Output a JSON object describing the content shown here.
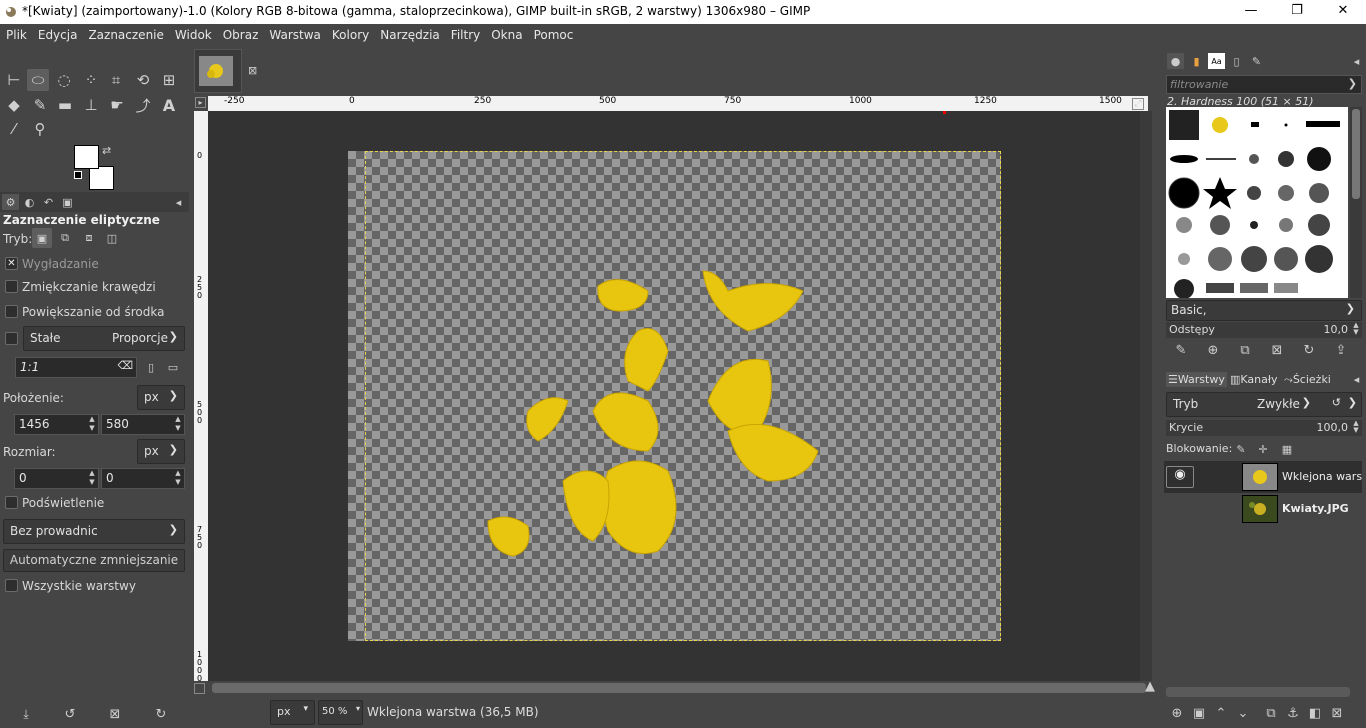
{
  "window": {
    "title": "*[Kwiaty] (zaimportowany)-1.0 (Kolory RGB 8-bitowa (gamma, staloprzecinkowa), GIMP built-in sRGB, 2 warstwy) 1306x980 – GIMP",
    "minimize": "—",
    "maximize": "❐",
    "close": "✕"
  },
  "menu": [
    "Plik",
    "Edycja",
    "Zaznaczenie",
    "Widok",
    "Obraz",
    "Warstwa",
    "Kolory",
    "Narzędzia",
    "Filtry",
    "Okna",
    "Pomoc"
  ],
  "tool_options": {
    "title": "Zaznaczenie eliptyczne",
    "mode_label": "Tryb:",
    "antialias": "Wygładzanie",
    "feather": "Zmiękczanie krawędzi",
    "expand_center": "Powiększanie od środka",
    "fixed_label": "Stałe",
    "fixed_value": "Proporcje",
    "ratio": "1:1",
    "position_label": "Położenie:",
    "position_unit": "px",
    "pos_x": "1456",
    "pos_y": "580",
    "size_label": "Rozmiar:",
    "size_unit": "px",
    "size_w": "0",
    "size_h": "0",
    "highlight": "Podświetlenie",
    "guides": "Bez prowadnic",
    "auto_shrink": "Automatyczne zmniejszanie",
    "all_layers": "Wszystkie warstwy"
  },
  "ruler": {
    "h_labels": [
      "-250",
      "0",
      "250",
      "500",
      "750",
      "1000",
      "1250",
      "1500"
    ],
    "v_labels": [
      "0",
      "250",
      "500",
      "750",
      "1000"
    ]
  },
  "status": {
    "unit": "px",
    "zoom": "50 %",
    "info": "Wklejona warstwa (36,5 MB)"
  },
  "brushes": {
    "filter_placeholder": "filtrowanie",
    "selected_name": "2. Hardness 100 (51 × 51)",
    "preset": "Basic,",
    "spacing_label": "Odstępy",
    "spacing_value": "10,0"
  },
  "layers": {
    "tabs": [
      "Warstwy",
      "Kanały",
      "Ścieżki"
    ],
    "mode_label": "Tryb",
    "mode_value": "Zwykłe",
    "opacity_label": "Krycie",
    "opacity_value": "100,0",
    "lock_label": "Blokowanie:",
    "items": [
      {
        "name": "Wklejona warstwa",
        "visible": true
      },
      {
        "name": "Kwiaty.JPG",
        "visible": false
      }
    ]
  }
}
